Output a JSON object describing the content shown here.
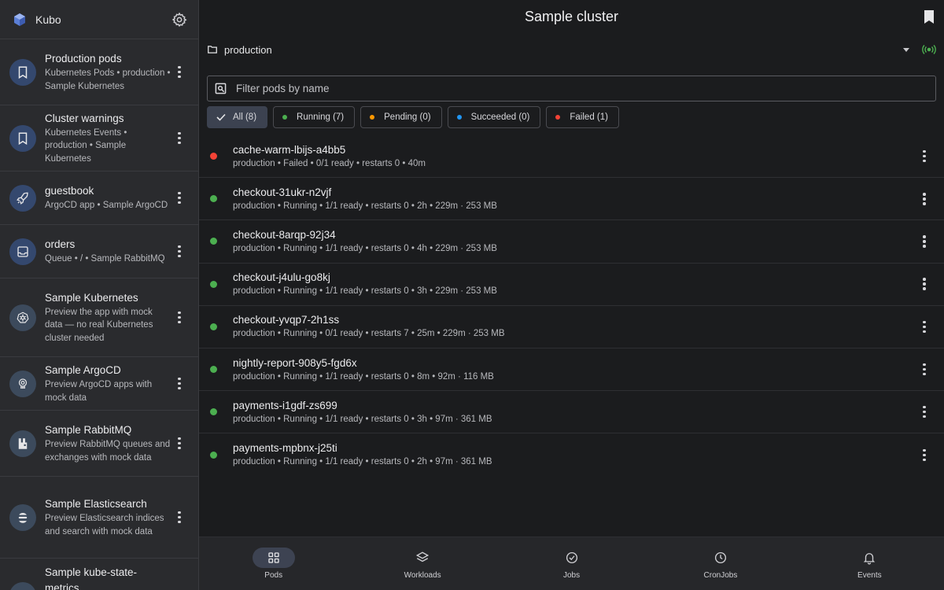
{
  "sidebar": {
    "app_name": "Kubo",
    "items": [
      {
        "title": "Production pods",
        "subtitle": "Kubernetes Pods • production • Sample Kubernetes",
        "icon": "bookmark-icon"
      },
      {
        "title": "Cluster warnings",
        "subtitle": "Kubernetes Events • production • Sample Kubernetes",
        "icon": "bookmark-icon"
      },
      {
        "title": "guestbook",
        "subtitle": "ArgoCD app • Sample ArgoCD",
        "icon": "rocket-icon"
      },
      {
        "title": "orders",
        "subtitle": "Queue • / • Sample RabbitMQ",
        "icon": "inbox-icon"
      },
      {
        "title": "Sample Kubernetes",
        "subtitle": "Preview the app with mock data — no real Kubernetes cluster needed",
        "icon": "kubernetes-icon"
      },
      {
        "title": "Sample ArgoCD",
        "subtitle": "Preview ArgoCD apps with mock data",
        "icon": "argocd-icon"
      },
      {
        "title": "Sample RabbitMQ",
        "subtitle": "Preview RabbitMQ queues and exchanges with mock data",
        "icon": "rabbitmq-icon"
      },
      {
        "title": "Sample Elasticsearch",
        "subtitle": "Preview Elasticsearch indices and search with mock data",
        "icon": "elasticsearch-icon"
      },
      {
        "title": "Sample kube-state-metrics",
        "subtitle": "",
        "icon": "metrics-icon"
      }
    ]
  },
  "header": {
    "title": "Sample cluster"
  },
  "namespace": {
    "value": "production"
  },
  "filter": {
    "placeholder": "Filter pods by name"
  },
  "chips": [
    {
      "label": "All (8)",
      "selected": true,
      "color": ""
    },
    {
      "label": "Running (7)",
      "selected": false,
      "color": "#4caf50"
    },
    {
      "label": "Pending (0)",
      "selected": false,
      "color": "#ff9800"
    },
    {
      "label": "Succeeded (0)",
      "selected": false,
      "color": "#2196f3"
    },
    {
      "label": "Failed (1)",
      "selected": false,
      "color": "#f44336"
    }
  ],
  "pods": [
    {
      "name": "cache-warm-lbijs-a4bb5",
      "meta": "production • Failed • 0/1 ready • restarts 0 • 40m",
      "status_color": "#f44336"
    },
    {
      "name": "checkout-31ukr-n2vjf",
      "meta": "production • Running • 1/1 ready • restarts 0 • 2h • 229m · 253 MB",
      "status_color": "#4caf50"
    },
    {
      "name": "checkout-8arqp-92j34",
      "meta": "production • Running • 1/1 ready • restarts 0 • 4h • 229m · 253 MB",
      "status_color": "#4caf50"
    },
    {
      "name": "checkout-j4ulu-go8kj",
      "meta": "production • Running • 1/1 ready • restarts 0 • 3h • 229m · 253 MB",
      "status_color": "#4caf50"
    },
    {
      "name": "checkout-yvqp7-2h1ss",
      "meta": "production • Running • 0/1 ready • restarts 7 • 25m • 229m · 253 MB",
      "status_color": "#4caf50"
    },
    {
      "name": "nightly-report-908y5-fgd6x",
      "meta": "production • Running • 1/1 ready • restarts 0 • 8m • 92m · 116 MB",
      "status_color": "#4caf50"
    },
    {
      "name": "payments-i1gdf-zs699",
      "meta": "production • Running • 1/1 ready • restarts 0 • 3h • 97m · 361 MB",
      "status_color": "#4caf50"
    },
    {
      "name": "payments-mpbnx-j25ti",
      "meta": "production • Running • 1/1 ready • restarts 0 • 2h • 97m · 361 MB",
      "status_color": "#4caf50"
    }
  ],
  "bottom_nav": [
    {
      "label": "Pods",
      "icon": "grid-icon",
      "active": true
    },
    {
      "label": "Workloads",
      "icon": "layers-icon",
      "active": false
    },
    {
      "label": "Jobs",
      "icon": "check-circle-icon",
      "active": false
    },
    {
      "label": "CronJobs",
      "icon": "clock-icon",
      "active": false
    },
    {
      "label": "Events",
      "icon": "bell-icon",
      "active": false
    }
  ]
}
